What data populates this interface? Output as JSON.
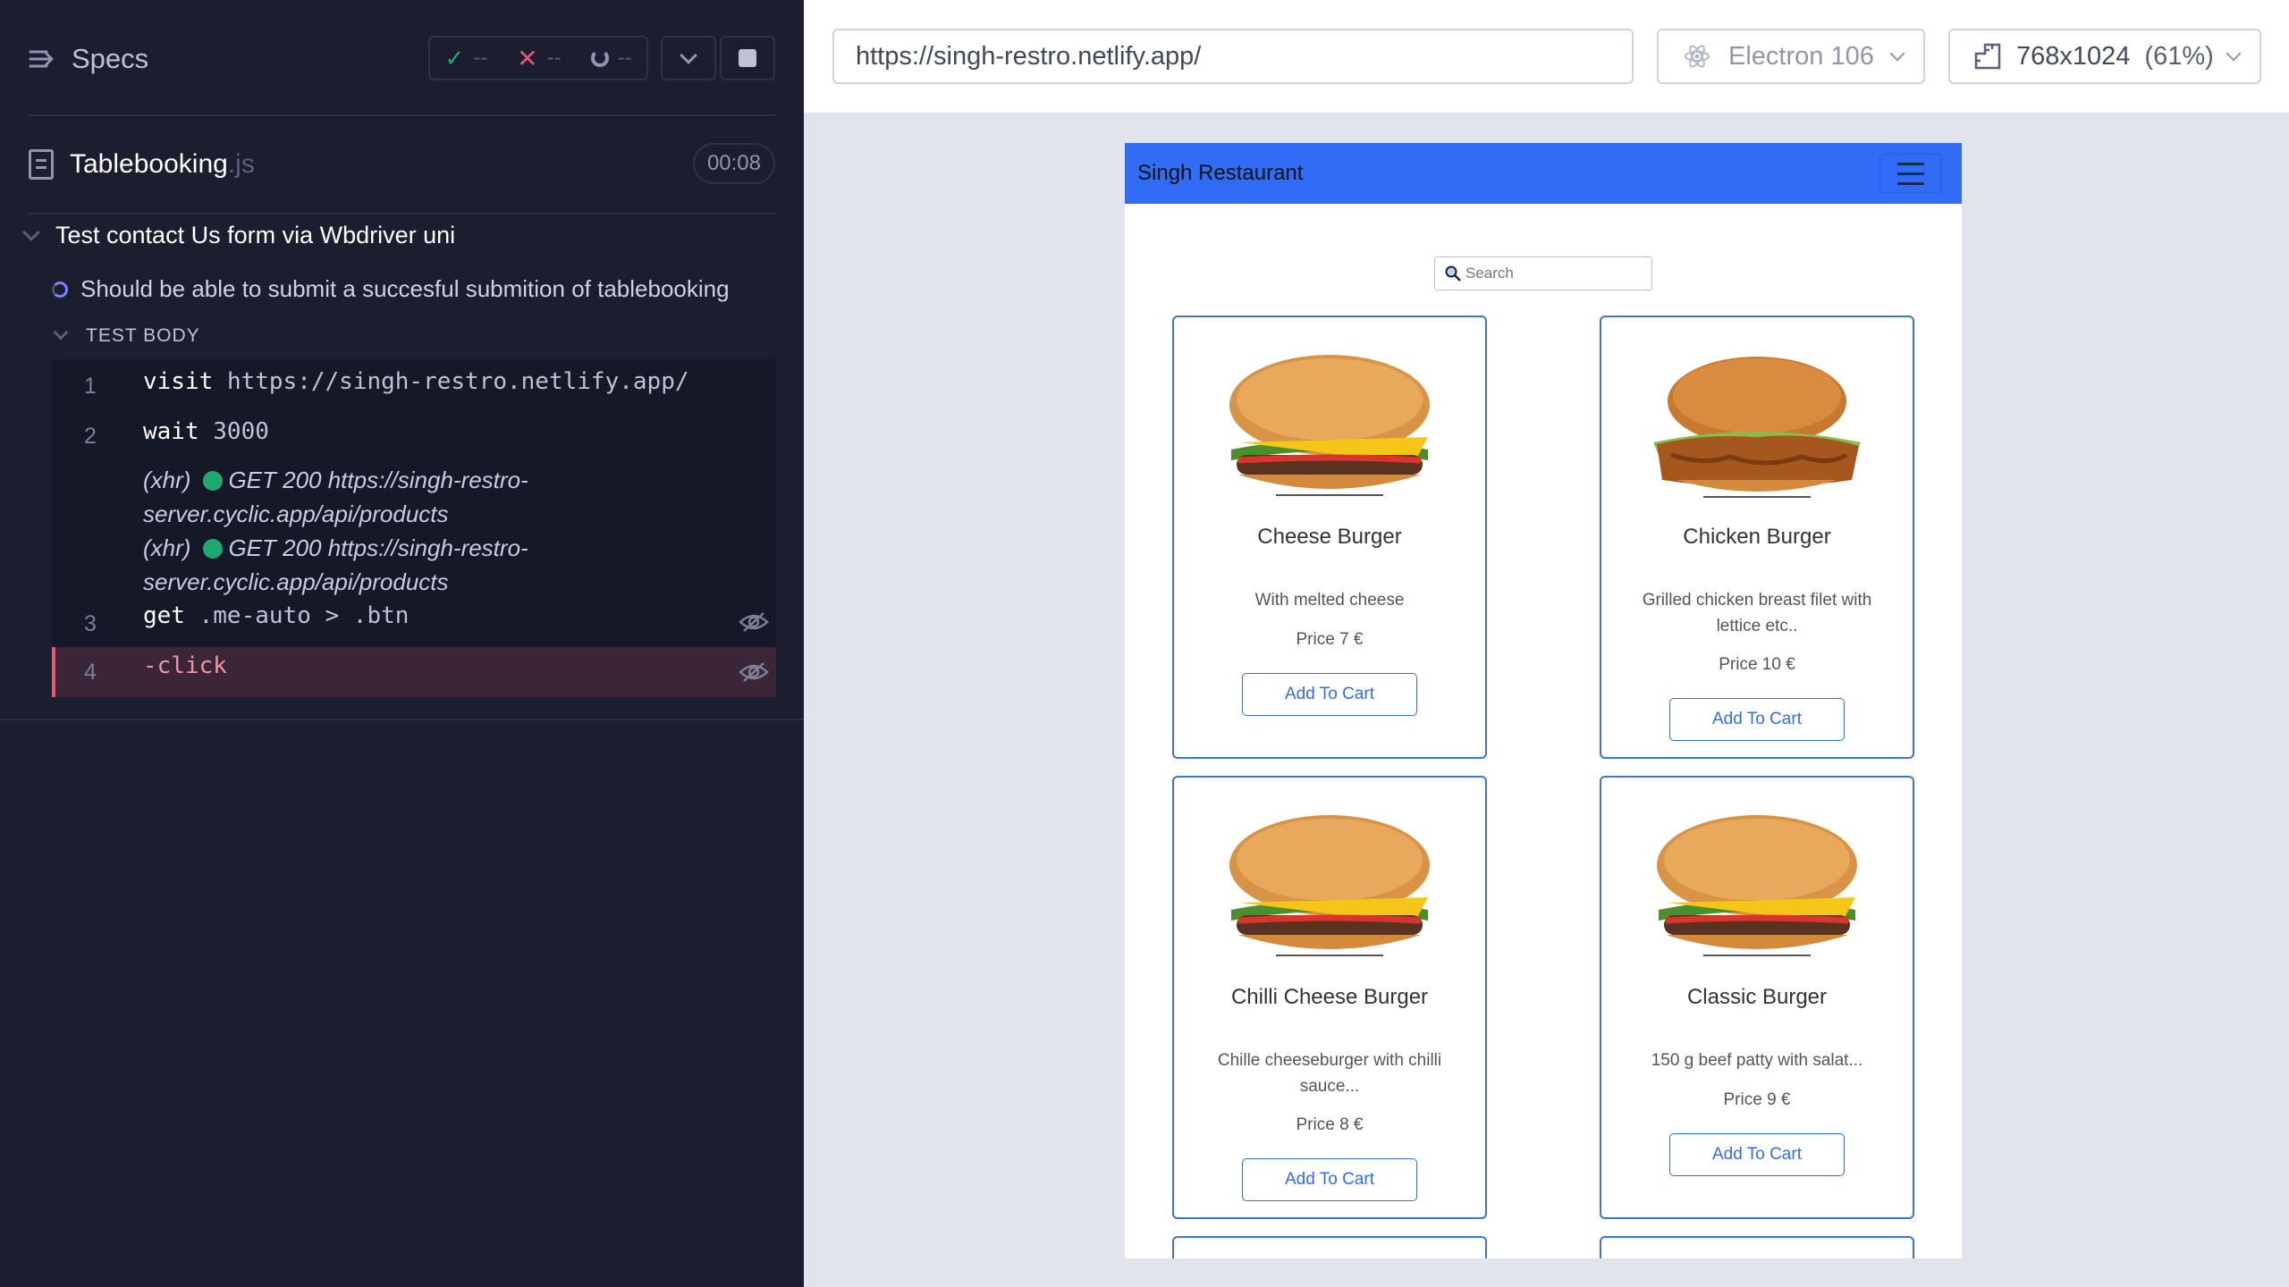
{
  "reporter": {
    "title": "Specs",
    "stats": {
      "passed": "--",
      "failed": "--",
      "pending": "--"
    },
    "spec_file": {
      "name": "Tablebooking",
      "ext": ".js",
      "duration": "00:08"
    },
    "suite_title": "Test contact Us form via Wbdriver uni",
    "test_title": "Should be able to submit a succesful submition of tablebooking",
    "body_label": "TEST BODY",
    "commands": [
      {
        "num": "1",
        "name": "visit",
        "message": "https://singh-restro.netlify.app/"
      },
      {
        "num": "2",
        "name": "wait",
        "message": "3000"
      },
      {
        "num": "3",
        "name": "get",
        "message": ".me-auto > .btn"
      },
      {
        "num": "4",
        "name": "-click",
        "message": ""
      }
    ],
    "xhr": [
      {
        "prefix": "(xhr)",
        "line1": "GET 200 https://singh-restro-",
        "line2": "server.cyclic.app/api/products"
      },
      {
        "prefix": "(xhr)",
        "line1": "GET 200 https://singh-restro-",
        "line2": "server.cyclic.app/api/products"
      }
    ]
  },
  "aut": {
    "url": "https://singh-restro.netlify.app/",
    "browser": "Electron 106",
    "viewport": "768x1024",
    "scale": "(61%)"
  },
  "app": {
    "brand": "Singh Restaurant",
    "search_placeholder": "Search",
    "add_label": "Add To Cart",
    "products": [
      {
        "name": "Cheese Burger",
        "desc": "With melted cheese",
        "price": "Price 7 €"
      },
      {
        "name": "Chicken Burger",
        "desc": "Grilled chicken breast filet with lettice etc..",
        "price": "Price 10 €"
      },
      {
        "name": "Chilli Cheese Burger",
        "desc": "Chille cheeseburger with chilli sauce...",
        "price": "Price 8 €"
      },
      {
        "name": "Classic Burger",
        "desc": "150 g beef patty with salat...",
        "price": "Price 9 €"
      }
    ]
  },
  "colors": {
    "reporter_bg": "#1b1e2e",
    "navbar": "#306cf6",
    "pass": "#1fa971",
    "fail": "#e45770"
  }
}
